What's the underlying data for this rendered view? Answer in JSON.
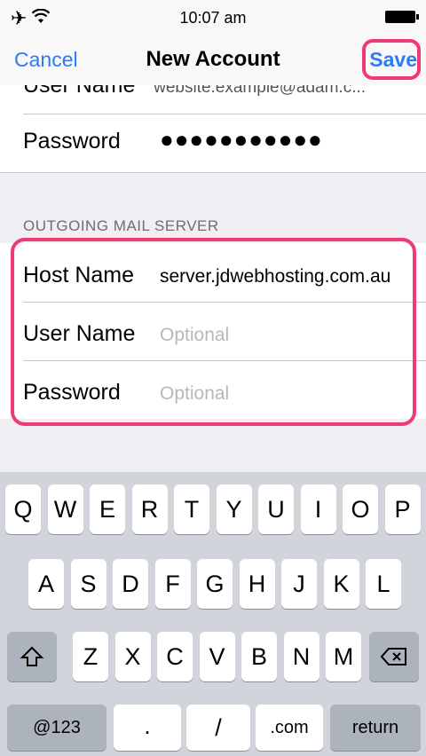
{
  "status_bar": {
    "time": "10:07 am"
  },
  "nav": {
    "cancel": "Cancel",
    "title": "New Account",
    "save": "Save"
  },
  "incoming": {
    "user_name_label": "User Name",
    "user_name_value": "website.example@adam.c...",
    "password_label": "Password",
    "password_value": "●●●●●●●●●●●"
  },
  "outgoing": {
    "header": "OUTGOING MAIL SERVER",
    "host_label": "Host Name",
    "host_value": "server.jdwebhosting.com.au",
    "user_label": "User Name",
    "user_placeholder": "Optional",
    "password_label": "Password",
    "password_placeholder": "Optional"
  },
  "keyboard": {
    "row1": [
      "Q",
      "W",
      "E",
      "R",
      "T",
      "Y",
      "U",
      "I",
      "O",
      "P"
    ],
    "row2": [
      "A",
      "S",
      "D",
      "F",
      "G",
      "H",
      "J",
      "K",
      "L"
    ],
    "row3": [
      "Z",
      "X",
      "C",
      "V",
      "B",
      "N",
      "M"
    ],
    "mode_key": "@123",
    "dot_key": ".",
    "slash_key": "/",
    "com_key": ".com",
    "return_key": "return",
    "shift_icon": "shift-icon",
    "delete_icon": "delete-icon"
  }
}
